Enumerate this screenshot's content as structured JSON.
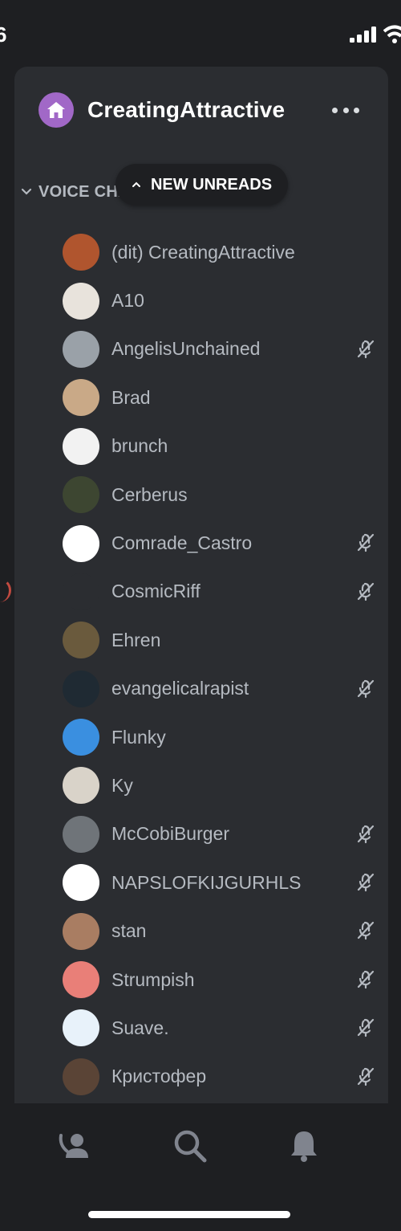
{
  "status_bar": {
    "time": "6"
  },
  "server": {
    "name": "CreatingAttractive",
    "icon": "home-icon",
    "accent_color": "#a168c7"
  },
  "category": {
    "label": "VOICE CHANNELS"
  },
  "unread_pill": {
    "label": "NEW UNREADS"
  },
  "members": [
    {
      "name": "(dit) CreatingAttractive",
      "muted": false,
      "avatar_color": "#b0552e"
    },
    {
      "name": "A10",
      "muted": false,
      "avatar_color": "#e8e3dc"
    },
    {
      "name": "AngelisUnchained",
      "muted": true,
      "avatar_color": "#9aa1a8"
    },
    {
      "name": "Brad",
      "muted": false,
      "avatar_color": "#c9a987"
    },
    {
      "name": "brunch",
      "muted": false,
      "avatar_color": "#f2f2f2"
    },
    {
      "name": "Cerberus",
      "muted": false,
      "avatar_color": "#3d4631"
    },
    {
      "name": "Comrade_Castro",
      "muted": true,
      "avatar_color": "#ffffff"
    },
    {
      "name": "CosmicRiff",
      "muted": true,
      "avatar_color": "#2b2d31"
    },
    {
      "name": "Ehren",
      "muted": false,
      "avatar_color": "#6a5a3d"
    },
    {
      "name": "evangelicalrapist",
      "muted": true,
      "avatar_color": "#1f2a33"
    },
    {
      "name": "Flunky",
      "muted": false,
      "avatar_color": "#3a8fe0"
    },
    {
      "name": "Ky",
      "muted": false,
      "avatar_color": "#d9d3c9"
    },
    {
      "name": "McCobiBurger",
      "muted": true,
      "avatar_color": "#6f7479"
    },
    {
      "name": "NAPSLOFKIJGURHLS",
      "muted": true,
      "avatar_color": "#ffffff"
    },
    {
      "name": "stan",
      "muted": true,
      "avatar_color": "#a97d62"
    },
    {
      "name": "Strumpish",
      "muted": true,
      "avatar_color": "#e97f78"
    },
    {
      "name": "Suave.",
      "muted": true,
      "avatar_color": "#e8f2fa"
    },
    {
      "name": "Кристофер",
      "muted": true,
      "avatar_color": "#5a4436"
    }
  ],
  "bottom_nav": [
    {
      "icon": "friends-icon"
    },
    {
      "icon": "search-icon"
    },
    {
      "icon": "bell-icon"
    }
  ]
}
